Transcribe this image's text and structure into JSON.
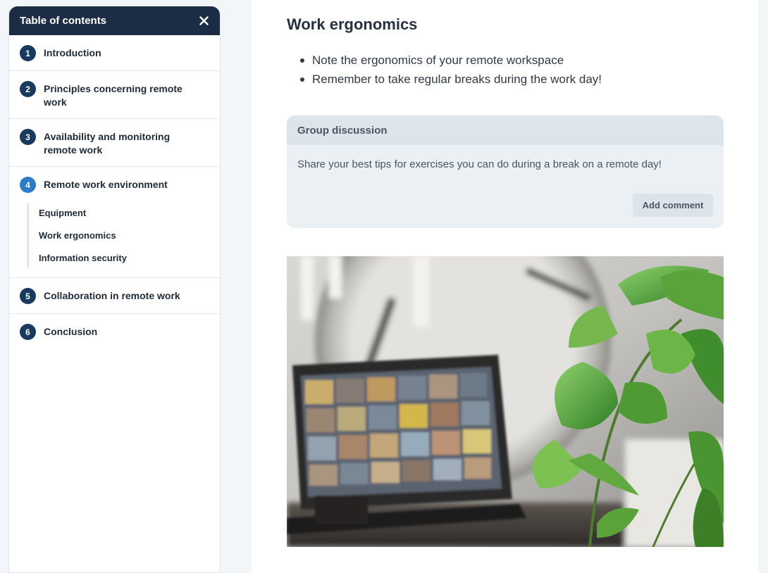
{
  "toc": {
    "title": "Table of contents",
    "close_icon": "close-icon",
    "items": [
      {
        "number": "1",
        "label": "Introduction"
      },
      {
        "number": "2",
        "label": "Principles concerning remote work"
      },
      {
        "number": "3",
        "label": "Availability and monitoring remote work"
      },
      {
        "number": "4",
        "label": "Remote work environment",
        "active": true,
        "subitems": [
          "Equipment",
          "Work ergonomics",
          "Information security"
        ]
      },
      {
        "number": "5",
        "label": "Collaboration in remote work"
      },
      {
        "number": "6",
        "label": "Conclusion"
      }
    ]
  },
  "main": {
    "title": "Work ergonomics",
    "bullets": [
      "Note the ergonomics of your remote workspace",
      "Remember to take regular breaks during the work day!"
    ],
    "discussion": {
      "header": "Group discussion",
      "prompt": "Share your best tips for exercises you can do during a break on a remote day!",
      "button_label": "Add comment"
    }
  },
  "colors": {
    "header_bg": "#1c2c44",
    "number_badge": "#173a5e",
    "active_badge": "#2b7bc6",
    "discussion_bg": "#ebf0f5"
  }
}
